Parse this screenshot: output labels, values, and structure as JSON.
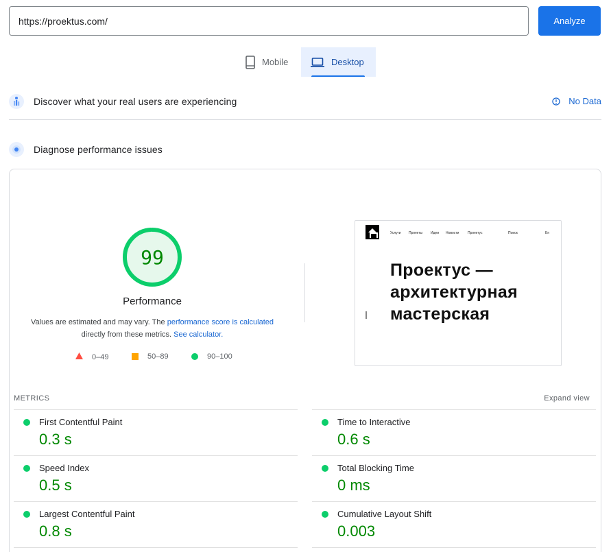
{
  "search": {
    "url": "https://proektus.com/"
  },
  "toolbar": {
    "analyze_label": "Analyze"
  },
  "tabs": [
    {
      "label": "Mobile",
      "icon": "phone-icon",
      "active": false
    },
    {
      "label": "Desktop",
      "icon": "laptop-icon",
      "active": true
    }
  ],
  "field_data": {
    "title": "Discover what your real users are experiencing",
    "status": "No Data"
  },
  "lab_data": {
    "title": "Diagnose performance issues"
  },
  "performance": {
    "score": 99,
    "label": "Performance",
    "note_prefix": "Values are estimated and may vary. The ",
    "note_link1": "performance score is calculated",
    "note_middle": " directly from these metrics. ",
    "note_link2": "See calculator.",
    "legend": [
      {
        "range": "0–49",
        "color": "#ff4e42"
      },
      {
        "range": "50–89",
        "color": "#ffa400"
      },
      {
        "range": "90–100",
        "color": "#0cce6b"
      }
    ]
  },
  "screenshot": {
    "nav": [
      "Услуги",
      "Проекты",
      "Идеи",
      "Новости",
      "Проектус",
      "Поиск",
      "En"
    ],
    "heading": "Проектус — архитектурная мастерская"
  },
  "metrics": {
    "header": "METRICS",
    "expand_label": "Expand view",
    "items": [
      {
        "label": "First Contentful Paint",
        "value": "0.3 s"
      },
      {
        "label": "Time to Interactive",
        "value": "0.6 s"
      },
      {
        "label": "Speed Index",
        "value": "0.5 s"
      },
      {
        "label": "Total Blocking Time",
        "value": "0 ms"
      },
      {
        "label": "Largest Contentful Paint",
        "value": "0.8 s"
      },
      {
        "label": "Cumulative Layout Shift",
        "value": "0.003"
      }
    ]
  },
  "colors": {
    "accent": "#1a73e8",
    "pass": "#0cce6b",
    "pass_text": "#008800",
    "average": "#ffa400",
    "fail": "#ff4e42"
  }
}
